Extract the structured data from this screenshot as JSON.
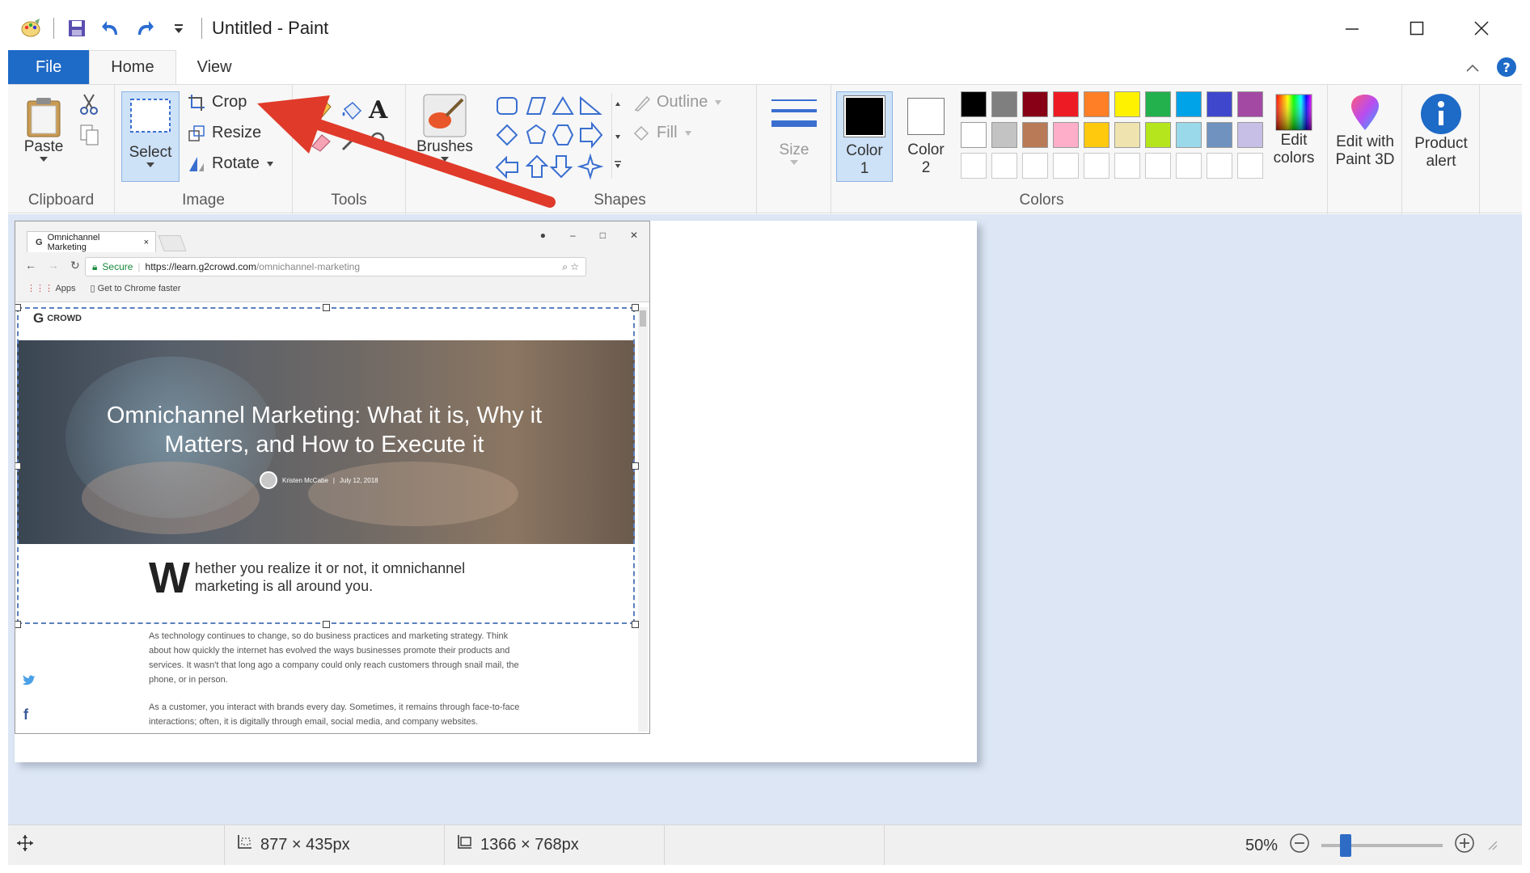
{
  "window": {
    "title": "Untitled - Paint",
    "icons": [
      "paint-app-icon",
      "save-icon",
      "undo-icon",
      "redo-icon",
      "customize-qat-icon"
    ],
    "controls": [
      "minimize-icon",
      "maximize-icon",
      "close-icon"
    ]
  },
  "tabs": [
    {
      "label": "File"
    },
    {
      "label": "Home"
    },
    {
      "label": "View"
    }
  ],
  "ribbon": {
    "clipboard": {
      "label": "Clipboard",
      "paste": "Paste"
    },
    "image": {
      "label": "Image",
      "select": "Select",
      "crop": "Crop",
      "resize": "Resize",
      "rotate": "Rotate"
    },
    "tools": {
      "label": "Tools"
    },
    "brushes": {
      "label": "Brushes"
    },
    "shapes": {
      "label": "Shapes",
      "outline": "Outline",
      "fill": "Fill"
    },
    "size": {
      "label": "Size"
    },
    "color1": {
      "label_a": "Color",
      "label_b": "1"
    },
    "color2": {
      "label_a": "Color",
      "label_b": "2"
    },
    "colors": {
      "label": "Colors",
      "row1": [
        "#000000",
        "#7f7f7f",
        "#880015",
        "#ed1c24",
        "#ff7f27",
        "#fff200",
        "#22b14c",
        "#00a2e8",
        "#3f48cc",
        "#a349a4"
      ],
      "row2": [
        "#ffffff",
        "#c3c3c3",
        "#b97a57",
        "#ffaec9",
        "#ffc90e",
        "#efe4b0",
        "#b5e61d",
        "#99d9ea",
        "#7092be",
        "#c8bfe7"
      ]
    },
    "edit_colors": {
      "label_a": "Edit",
      "label_b": "colors"
    },
    "paint3d": {
      "label_a": "Edit with",
      "label_b": "Paint 3D"
    },
    "product_alert": {
      "label_a": "Product",
      "label_b": "alert"
    }
  },
  "canvas_image": {
    "browser_tab": "Omnichannel Marketing",
    "secure": "Secure",
    "url_host": "https://learn.g2crowd.com",
    "url_path": "/omnichannel-marketing",
    "bookmark_apps": "Apps",
    "bookmark_chrome": "Get to Chrome faster",
    "site_logo": "CROWD",
    "hero_title": "Omnichannel Marketing: What it is, Why it Matters, and How to Execute it",
    "hero_author": "Kristen McCabe",
    "hero_date": "July 12, 2018",
    "lead_dropcap": "W",
    "lead_text": "hether you realize it or not, it omnichannel marketing is all around you.",
    "para1": "As technology continues to change, so do business practices and marketing strategy. Think about how quickly the internet has evolved the ways businesses promote their products and services. It wasn't that long ago a company could only reach customers through snail mail, the phone, or in person.",
    "para2": "As a customer, you interact with brands every day. Sometimes, it remains through face-to-face interactions; often, it is digitally through email, social media, and company websites."
  },
  "status": {
    "selection_size": "877 × 435px",
    "image_size": "1366 × 768px",
    "zoom": "50%",
    "zoom_fraction": 0.2
  }
}
